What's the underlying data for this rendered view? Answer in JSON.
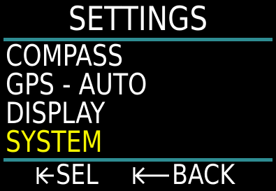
{
  "screen": {
    "title": "SETTINGS",
    "colors": {
      "background": "#000000",
      "text": "#ffffff",
      "selected": "#f5f500",
      "rule": "#2e8c92"
    }
  },
  "menu": {
    "items": [
      {
        "label": "COMPASS",
        "selected": false
      },
      {
        "label": "GPS - AUTO",
        "selected": false
      },
      {
        "label": "DISPLAY",
        "selected": false
      },
      {
        "label": "SYSTEM",
        "selected": true
      }
    ]
  },
  "footer": {
    "select": {
      "icon": "short-arrow-to-bar-left-icon",
      "label": "SEL"
    },
    "back": {
      "icon": "long-arrow-to-bar-left-icon",
      "label": "BACK"
    }
  }
}
